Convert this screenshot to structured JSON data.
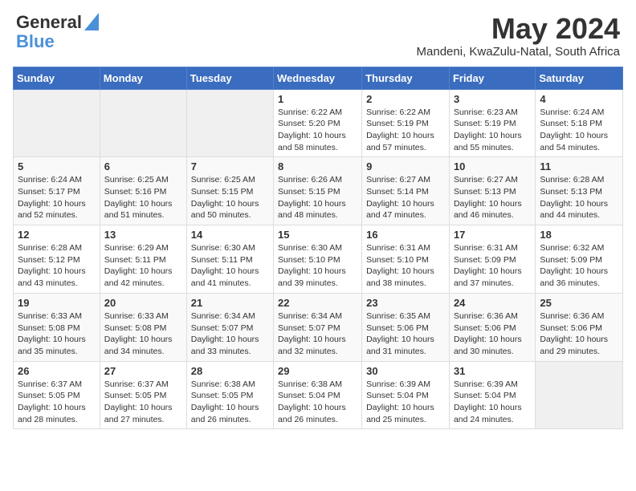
{
  "header": {
    "logo_line1": "General",
    "logo_line2": "Blue",
    "month": "May 2024",
    "location": "Mandeni, KwaZulu-Natal, South Africa"
  },
  "days_of_week": [
    "Sunday",
    "Monday",
    "Tuesday",
    "Wednesday",
    "Thursday",
    "Friday",
    "Saturday"
  ],
  "weeks": [
    [
      {
        "day": "",
        "info": ""
      },
      {
        "day": "",
        "info": ""
      },
      {
        "day": "",
        "info": ""
      },
      {
        "day": "1",
        "info": "Sunrise: 6:22 AM\nSunset: 5:20 PM\nDaylight: 10 hours\nand 58 minutes."
      },
      {
        "day": "2",
        "info": "Sunrise: 6:22 AM\nSunset: 5:19 PM\nDaylight: 10 hours\nand 57 minutes."
      },
      {
        "day": "3",
        "info": "Sunrise: 6:23 AM\nSunset: 5:19 PM\nDaylight: 10 hours\nand 55 minutes."
      },
      {
        "day": "4",
        "info": "Sunrise: 6:24 AM\nSunset: 5:18 PM\nDaylight: 10 hours\nand 54 minutes."
      }
    ],
    [
      {
        "day": "5",
        "info": "Sunrise: 6:24 AM\nSunset: 5:17 PM\nDaylight: 10 hours\nand 52 minutes."
      },
      {
        "day": "6",
        "info": "Sunrise: 6:25 AM\nSunset: 5:16 PM\nDaylight: 10 hours\nand 51 minutes."
      },
      {
        "day": "7",
        "info": "Sunrise: 6:25 AM\nSunset: 5:15 PM\nDaylight: 10 hours\nand 50 minutes."
      },
      {
        "day": "8",
        "info": "Sunrise: 6:26 AM\nSunset: 5:15 PM\nDaylight: 10 hours\nand 48 minutes."
      },
      {
        "day": "9",
        "info": "Sunrise: 6:27 AM\nSunset: 5:14 PM\nDaylight: 10 hours\nand 47 minutes."
      },
      {
        "day": "10",
        "info": "Sunrise: 6:27 AM\nSunset: 5:13 PM\nDaylight: 10 hours\nand 46 minutes."
      },
      {
        "day": "11",
        "info": "Sunrise: 6:28 AM\nSunset: 5:13 PM\nDaylight: 10 hours\nand 44 minutes."
      }
    ],
    [
      {
        "day": "12",
        "info": "Sunrise: 6:28 AM\nSunset: 5:12 PM\nDaylight: 10 hours\nand 43 minutes."
      },
      {
        "day": "13",
        "info": "Sunrise: 6:29 AM\nSunset: 5:11 PM\nDaylight: 10 hours\nand 42 minutes."
      },
      {
        "day": "14",
        "info": "Sunrise: 6:30 AM\nSunset: 5:11 PM\nDaylight: 10 hours\nand 41 minutes."
      },
      {
        "day": "15",
        "info": "Sunrise: 6:30 AM\nSunset: 5:10 PM\nDaylight: 10 hours\nand 39 minutes."
      },
      {
        "day": "16",
        "info": "Sunrise: 6:31 AM\nSunset: 5:10 PM\nDaylight: 10 hours\nand 38 minutes."
      },
      {
        "day": "17",
        "info": "Sunrise: 6:31 AM\nSunset: 5:09 PM\nDaylight: 10 hours\nand 37 minutes."
      },
      {
        "day": "18",
        "info": "Sunrise: 6:32 AM\nSunset: 5:09 PM\nDaylight: 10 hours\nand 36 minutes."
      }
    ],
    [
      {
        "day": "19",
        "info": "Sunrise: 6:33 AM\nSunset: 5:08 PM\nDaylight: 10 hours\nand 35 minutes."
      },
      {
        "day": "20",
        "info": "Sunrise: 6:33 AM\nSunset: 5:08 PM\nDaylight: 10 hours\nand 34 minutes."
      },
      {
        "day": "21",
        "info": "Sunrise: 6:34 AM\nSunset: 5:07 PM\nDaylight: 10 hours\nand 33 minutes."
      },
      {
        "day": "22",
        "info": "Sunrise: 6:34 AM\nSunset: 5:07 PM\nDaylight: 10 hours\nand 32 minutes."
      },
      {
        "day": "23",
        "info": "Sunrise: 6:35 AM\nSunset: 5:06 PM\nDaylight: 10 hours\nand 31 minutes."
      },
      {
        "day": "24",
        "info": "Sunrise: 6:36 AM\nSunset: 5:06 PM\nDaylight: 10 hours\nand 30 minutes."
      },
      {
        "day": "25",
        "info": "Sunrise: 6:36 AM\nSunset: 5:06 PM\nDaylight: 10 hours\nand 29 minutes."
      }
    ],
    [
      {
        "day": "26",
        "info": "Sunrise: 6:37 AM\nSunset: 5:05 PM\nDaylight: 10 hours\nand 28 minutes."
      },
      {
        "day": "27",
        "info": "Sunrise: 6:37 AM\nSunset: 5:05 PM\nDaylight: 10 hours\nand 27 minutes."
      },
      {
        "day": "28",
        "info": "Sunrise: 6:38 AM\nSunset: 5:05 PM\nDaylight: 10 hours\nand 26 minutes."
      },
      {
        "day": "29",
        "info": "Sunrise: 6:38 AM\nSunset: 5:04 PM\nDaylight: 10 hours\nand 26 minutes."
      },
      {
        "day": "30",
        "info": "Sunrise: 6:39 AM\nSunset: 5:04 PM\nDaylight: 10 hours\nand 25 minutes."
      },
      {
        "day": "31",
        "info": "Sunrise: 6:39 AM\nSunset: 5:04 PM\nDaylight: 10 hours\nand 24 minutes."
      },
      {
        "day": "",
        "info": ""
      }
    ]
  ]
}
